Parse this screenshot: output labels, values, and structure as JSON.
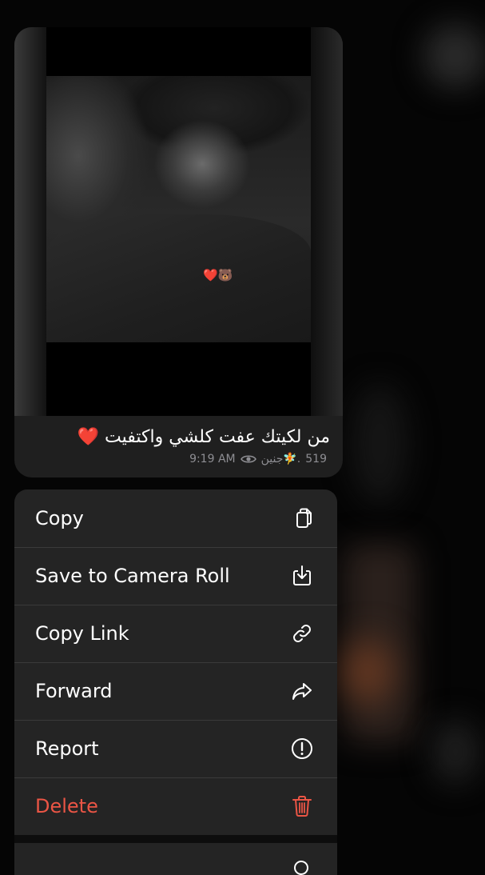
{
  "message": {
    "caption": "من لكيتك عفت كلشي واكتفيت ❤️",
    "photo_sticker": "❤️🐻",
    "views": "519",
    "author": "جنين🧚.",
    "time": "9:19 AM"
  },
  "menu": {
    "items": [
      {
        "label": "Copy",
        "icon": "copy-icon"
      },
      {
        "label": "Save to Camera Roll",
        "icon": "save-download-icon"
      },
      {
        "label": "Copy Link",
        "icon": "link-icon"
      },
      {
        "label": "Forward",
        "icon": "forward-arrow-icon"
      },
      {
        "label": "Report",
        "icon": "exclamation-circle-icon"
      },
      {
        "label": "Delete",
        "icon": "trash-icon"
      }
    ]
  },
  "colors": {
    "menu_background": "#242424",
    "danger": "#eb5545",
    "secondary_text": "#8e8e93"
  }
}
